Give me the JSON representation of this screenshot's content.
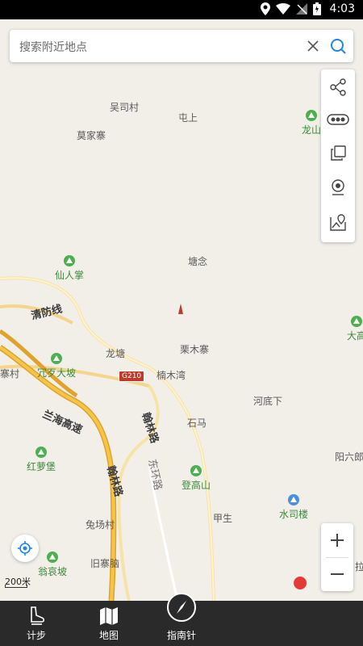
{
  "status_bar": {
    "time": "4:03"
  },
  "search": {
    "placeholder": "搜索附近地点"
  },
  "map": {
    "places": [
      "吴司村",
      "屯上",
      "莫家寨",
      "塘念",
      "龙塘",
      "栗木寨",
      "楠木湾",
      "河底下",
      "石马",
      "甲生",
      "兔场村",
      "旧寨脑",
      "阳六郎",
      "寨村",
      "拉"
    ],
    "pois": [
      "龙山",
      "仙人掌",
      "冗歹大坡",
      "红萝堡",
      "登高山",
      "水司楼",
      "翁哀坡",
      "大高"
    ],
    "roads": [
      "清防线",
      "兰海高速",
      "翰林路",
      "翰林路",
      "东环路"
    ],
    "road_shield": "G210",
    "scale_label": "200米"
  },
  "bottom_nav": {
    "items": [
      {
        "label": "计步"
      },
      {
        "label": "地图"
      },
      {
        "label": "指南针"
      }
    ]
  }
}
